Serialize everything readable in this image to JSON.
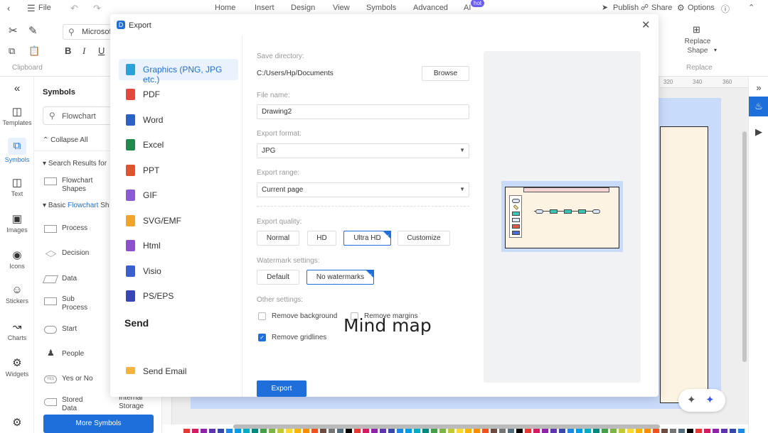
{
  "menubar": {
    "file_label": "File",
    "tabs": [
      "Home",
      "Insert",
      "Design",
      "View",
      "Symbols",
      "Advanced",
      "AI"
    ],
    "hot_badge": "hot",
    "publish_label": "Publish",
    "share_label": "Share",
    "options_label": "Options"
  },
  "ribbon": {
    "font_name": "Microsoft",
    "clipboard_label": "Clipboard",
    "replace_shape_label_line1": "Replace",
    "replace_shape_label_line2": "Shape",
    "replace_group_label": "Replace"
  },
  "leftrail": {
    "items": [
      {
        "label": "Templates"
      },
      {
        "label": "Symbols"
      },
      {
        "label": "Text"
      },
      {
        "label": "Images"
      },
      {
        "label": "Icons"
      },
      {
        "label": "Stickers"
      },
      {
        "label": "Charts"
      },
      {
        "label": "Widgets"
      }
    ]
  },
  "symbols": {
    "title": "Symbols",
    "search_value": "Flowchart",
    "collapse_all": "Collapse All",
    "search_results": "Search Results for",
    "flowchart_shapes_1": "Flowchart",
    "flowchart_shapes_2": "Shapes",
    "basic_prefix": "Basic",
    "basic_highlight": "Flowchart",
    "basic_suffix": "Sh",
    "items": [
      {
        "label": "Process"
      },
      {
        "label": "Decision"
      },
      {
        "label": "Data"
      },
      {
        "label": "Sub"
      },
      {
        "label": "Start"
      },
      {
        "label": "People"
      },
      {
        "label": "Yes or No"
      },
      {
        "label": "Stored"
      }
    ],
    "subprocess_line2": "Process",
    "stored_line2": "Data",
    "internal_storage": "Internal",
    "internal_storage_2": "Storage",
    "more_symbols": "More Symbols"
  },
  "ruler": {
    "ticks": [
      "320",
      "340",
      "360"
    ]
  },
  "dialog": {
    "title": "Export",
    "formats": [
      {
        "label": "Graphics (PNG, JPG etc.)",
        "color": "#29a3d8"
      },
      {
        "label": "PDF",
        "color": "#e5483d"
      },
      {
        "label": "Word",
        "color": "#2b62c7"
      },
      {
        "label": "Excel",
        "color": "#1f8a4c"
      },
      {
        "label": "PPT",
        "color": "#e0532f"
      },
      {
        "label": "GIF",
        "color": "#8b5bd6"
      },
      {
        "label": "SVG/EMF",
        "color": "#f0a52a"
      },
      {
        "label": "Html",
        "color": "#8e4fcf"
      },
      {
        "label": "Visio",
        "color": "#3b5fd1"
      },
      {
        "label": "PS/EPS",
        "color": "#3946b8"
      }
    ],
    "send_heading": "Send",
    "send_email": "Send Email",
    "save_dir_label": "Save directory:",
    "save_dir_value": "C:/Users/Hp/Documents",
    "browse": "Browse",
    "file_name_label": "File name:",
    "file_name_value": "Drawing2",
    "export_format_label": "Export format:",
    "export_format_value": "JPG",
    "export_range_label": "Export range:",
    "export_range_value": "Current page",
    "quality_label": "Export quality:",
    "quality_options": [
      "Normal",
      "HD",
      "Ultra HD",
      "Customize"
    ],
    "quality_selected": "Ultra HD",
    "watermark_label": "Watermark settings:",
    "watermark_options": [
      "Default",
      "No watermarks"
    ],
    "other_label": "Other settings:",
    "remove_background": "Remove background",
    "remove_margins": "Remove margins",
    "remove_gridlines": "Remove gridlines",
    "remove_gridlines_checked": true,
    "export_button": "Export"
  },
  "overlay_text": "Mind map",
  "colors": {
    "accent": "#1e6fd9",
    "page_bg": "#c9dbfb",
    "sheet": "#fdf3e3"
  }
}
